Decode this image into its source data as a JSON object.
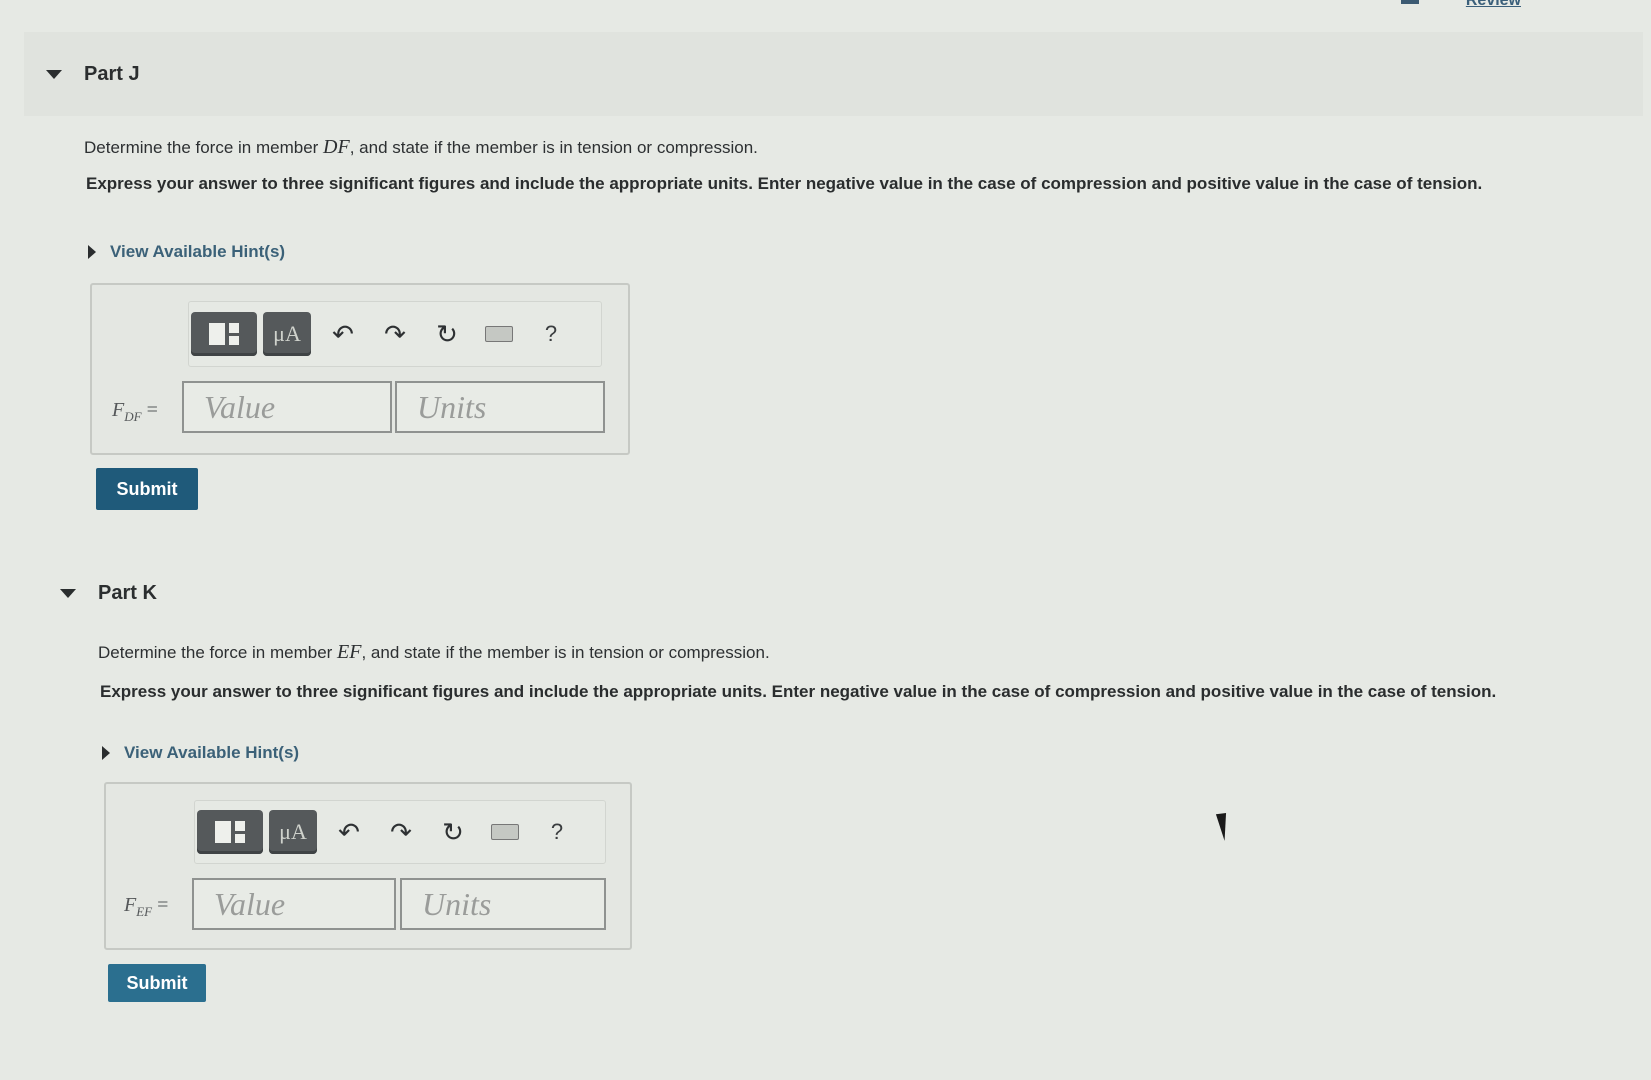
{
  "header": {
    "review_link": "Review"
  },
  "parts": [
    {
      "title": "Part J",
      "question_prefix": "Determine the force in member ",
      "member": "DF",
      "question_suffix": ", and state if the member is in tension or compression.",
      "instructions": "Express your answer to three significant figures and include the appropriate units. Enter negative value in the case of compression and positive value in the case of tension.",
      "hint_label": "View Available Hint(s)",
      "variable": "F",
      "variable_sub": "DF",
      "equals": "=",
      "value_placeholder": "Value",
      "units_placeholder": "Units",
      "submit_label": "Submit"
    },
    {
      "title": "Part K",
      "question_prefix": "Determine the force in member ",
      "member": "EF",
      "question_suffix": ", and state if the member is in tension or compression.",
      "instructions": "Express your answer to three significant figures and include the appropriate units. Enter negative value in the case of compression and positive value in the case of tension.",
      "hint_label": "View Available Hint(s)",
      "variable": "F",
      "variable_sub": "EF",
      "equals": "=",
      "value_placeholder": "Value",
      "units_placeholder": "Units",
      "submit_label": "Submit"
    }
  ],
  "toolbar": {
    "templates_icon": "templates-icon",
    "units_icon_text": "μA",
    "undo_icon": "undo-icon",
    "redo_icon": "redo-icon",
    "reset_icon": "reset-icon",
    "keyboard_icon": "keyboard-icon",
    "help_text": "?"
  }
}
